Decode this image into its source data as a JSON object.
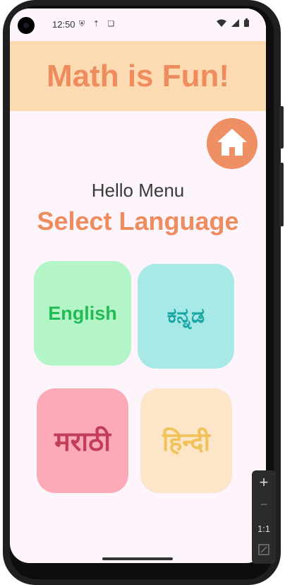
{
  "status_bar": {
    "time": "12:50",
    "left_icons": [
      "shield-icon",
      "usb-icon",
      "clipboard-icon"
    ],
    "right_icons": [
      "wifi-icon",
      "signal-icon",
      "battery-icon"
    ]
  },
  "header": {
    "title": "Math is Fun!",
    "background": "#fcdbb3",
    "title_color": "#ef8c5e"
  },
  "home_button": {
    "icon": "home-icon",
    "color": "#ef8f64"
  },
  "menu": {
    "greeting": "Hello Menu",
    "heading": "Select Language"
  },
  "languages": [
    {
      "label": "English",
      "background": "#b4f5c8",
      "text_color": "#22bb55"
    },
    {
      "label": "ಕನ್ನಡ",
      "background": "#a6e9e7",
      "text_color": "#1aa6a4"
    },
    {
      "label": "मराठी",
      "background": "#fcaab7",
      "text_color": "#c23d57"
    },
    {
      "label": "हिन्दी",
      "background": "#fde6c8",
      "text_color": "#f0c25a"
    }
  ],
  "zoom_controls": {
    "zoom_in": "+",
    "zoom_out": "−",
    "ratio": "1:1"
  }
}
